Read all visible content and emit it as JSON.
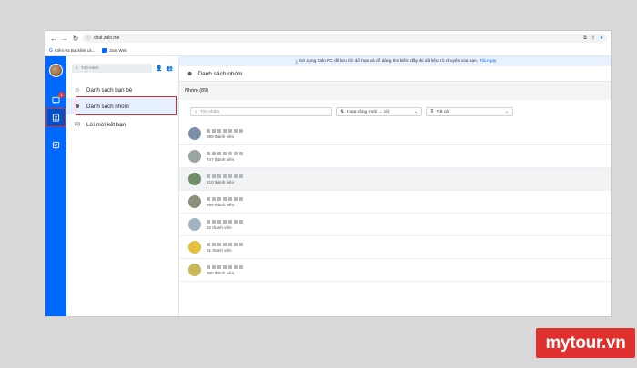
{
  "browser": {
    "url": "chat.zalo.me",
    "bookmarks": [
      {
        "label": "Kiểm tra Backlink cả...",
        "icon": "google-icon"
      },
      {
        "label": "Zalo Web",
        "icon": "zalo-icon"
      }
    ]
  },
  "banner": {
    "text": "Sử dụng Zalo PC để lưu trữ dài hạn và dễ dàng tìm kiếm đầy đủ dữ liệu trò chuyện của bạn.",
    "link": "Tải ngay"
  },
  "rail": {
    "badge_count": "1"
  },
  "panel": {
    "search_placeholder": "Tìm kiếm",
    "items": [
      {
        "label": "Danh sách bạn bè",
        "icon": "friends-icon"
      },
      {
        "label": "Danh sách nhóm",
        "icon": "groups-icon"
      },
      {
        "label": "Lời mời kết bạn",
        "icon": "envelope-icon"
      }
    ]
  },
  "main": {
    "title": "Danh sách nhóm",
    "count": "Nhóm (89)",
    "filters": {
      "search_placeholder": "Tìm nhóm",
      "sort": "Hoạt động (mới → cũ)",
      "type": "Tất cả"
    },
    "groups": [
      {
        "members": "999 thành viên",
        "color": "#7b8fa8"
      },
      {
        "members": "747 thành viên",
        "color": "#9aa5a0"
      },
      {
        "members": "510 thành viên",
        "color": "#6f8f6a"
      },
      {
        "members": "999 thành viên",
        "color": "#8b8f7c"
      },
      {
        "members": "52 thành viên",
        "color": "#a3b3c4"
      },
      {
        "members": "81 thành viên",
        "color": "#e3c03a"
      },
      {
        "members": "380 thành viên",
        "color": "#c8b85a"
      }
    ]
  },
  "watermark": "mytour.vn"
}
